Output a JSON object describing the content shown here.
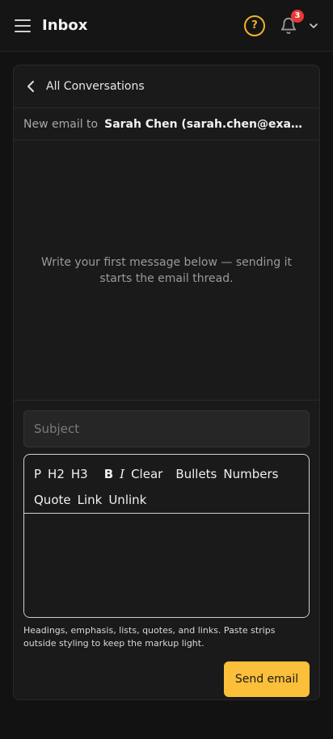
{
  "header": {
    "title": "Inbox",
    "notification_count": "3",
    "help_icon": "help-circle-icon",
    "bell_icon": "bell-icon",
    "account_menu_icon": "chevron-down-icon"
  },
  "nav": {
    "back_label": "All Conversations"
  },
  "recipient": {
    "prefix": "New email to",
    "display": "Sarah Chen (sarah.chen@example.com)"
  },
  "thread": {
    "empty_message": "Write your first message below — sending it starts the email thread."
  },
  "compose": {
    "subject_placeholder": "Subject",
    "subject_value": "",
    "toolbar": {
      "paragraph": "P",
      "h2": "H2",
      "h3": "H3",
      "bold": "B",
      "italic": "I",
      "clear": "Clear",
      "bullets": "Bullets",
      "numbers": "Numbers",
      "quote": "Quote",
      "link": "Link",
      "unlink": "Unlink"
    },
    "body_value": "",
    "helper_text": "Headings, emphasis, lists, quotes, and links. Paste strips outside styling to keep the markup light.",
    "send_label": "Send email"
  },
  "colors": {
    "background": "#121212",
    "card": "#1a1a1a",
    "accent": "#fbbf3a",
    "badge": "#e53935"
  }
}
